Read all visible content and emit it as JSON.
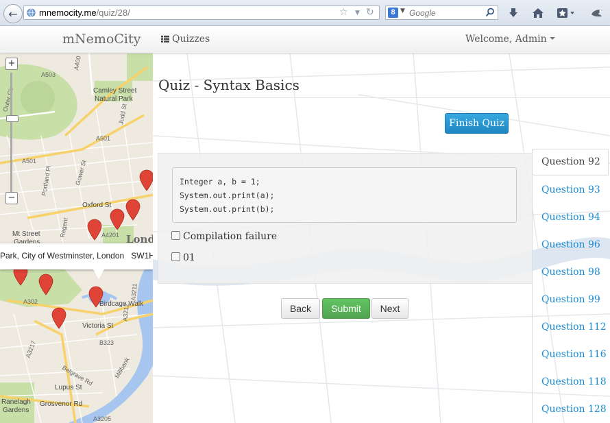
{
  "browser": {
    "url_host": "mnemocity.me",
    "url_path": "/quiz/28/",
    "search_placeholder": "Google",
    "search_engine_letter": "8"
  },
  "navbar": {
    "brand": "mNemoCity",
    "quizzes_label": "Quizzes",
    "welcome_label": "Welcome, Admin"
  },
  "map": {
    "info_bubble": {
      "text_prefix": "Park, City of Westminster, ",
      "city": "London",
      "postcode": "SW1H"
    },
    "labels": {
      "camley": "Camley Street",
      "natural_park": "Natural Park",
      "outer_circle": "Outer Cir",
      "oxford_street": "Oxford St",
      "mt_street": "Mt Street",
      "gardens": "Gardens",
      "london": "London",
      "birdcage_walk": "Birdcage Walk",
      "victoria_st": "Victoria St",
      "grosvenor_rd": "Grosvenor Rd",
      "lupus_st": "Lupus St",
      "belgrave_rd": "Belgrave Rd",
      "ranelagh": "Ranelagh",
      "ranelagh_gardens": "Gardens",
      "a503": "A503",
      "a501": "A501",
      "a400": "A400",
      "a4201": "A4201",
      "a3205": "A3205",
      "b323": "B323",
      "a302": "A302",
      "a3217": "A3217",
      "a3212": "A3212",
      "a3211": "A3211",
      "portland_pl": "Portland Pl",
      "gower_st": "Gower St",
      "judd_st": "Judd St",
      "regent": "Regent",
      "millbank": "Millbank"
    },
    "zoom_in": "+",
    "zoom_out": "−"
  },
  "quiz": {
    "title": "Quiz - Syntax Basics",
    "finish_button": "Finish Quiz",
    "code_lines": [
      "Integer a, b = 1;",
      "System.out.print(a);",
      "System.out.print(b);"
    ],
    "options": [
      "Compilation failure",
      "01"
    ],
    "buttons": {
      "back": "Back",
      "submit": "Submit",
      "next": "Next"
    }
  },
  "questions": [
    {
      "label": "Question 92",
      "active": true
    },
    {
      "label": "Question 93"
    },
    {
      "label": "Question 94"
    },
    {
      "label": "Question 96"
    },
    {
      "label": "Question 98"
    },
    {
      "label": "Question 99"
    },
    {
      "label": "Question 112"
    },
    {
      "label": "Question 116"
    },
    {
      "label": "Question 118"
    },
    {
      "label": "Question 128"
    }
  ],
  "colors": {
    "link": "#1a8cd0",
    "finish_button": "#2196d3",
    "submit_button": "#5bb75b",
    "map_park": "#c8dfa8",
    "map_water": "#a6c6f0",
    "map_road": "#f7d26a",
    "marker": "#e04436"
  }
}
